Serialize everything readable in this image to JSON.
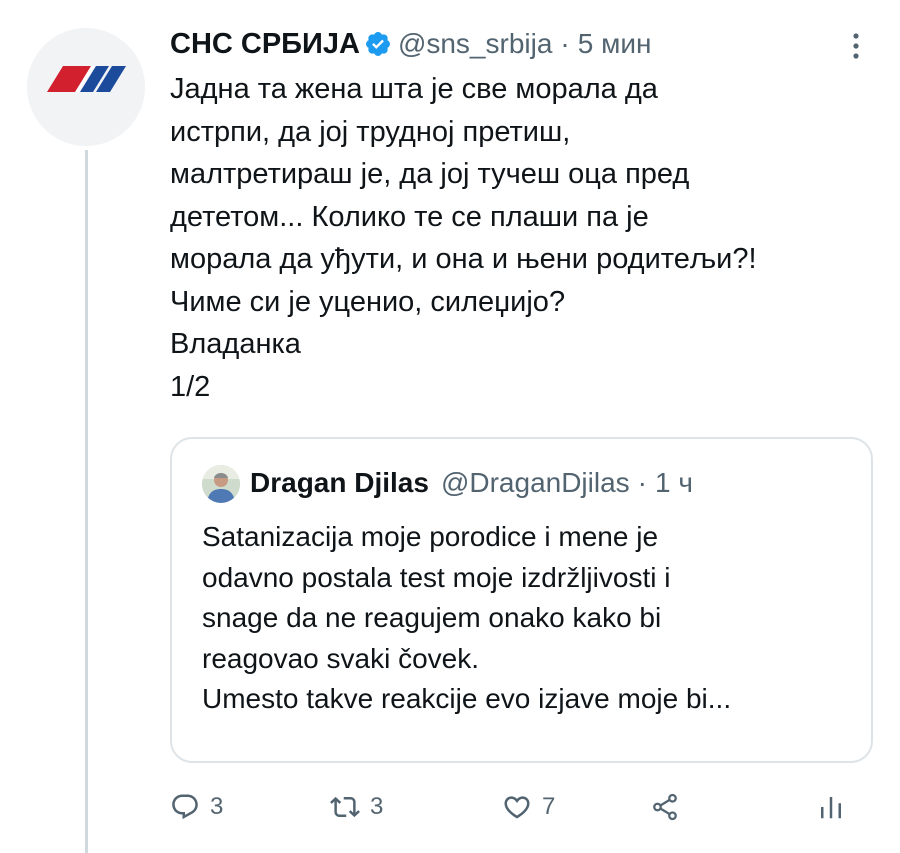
{
  "tweet": {
    "author": {
      "display_name": "СНС СРБИЈА",
      "handle": "@sns_srbija",
      "verified": true,
      "avatar_icon": "sns-logo-icon"
    },
    "separator": "·",
    "time": "5 мин",
    "more_icon": "more-vertical-icon",
    "text": "Јадна та жена шта је све морала да\nистрпи, да јој трудној претиш,\nмалтретираш је, да јој тучеш оца пред\nдететом... Колико те се плаши па је\nморала да уђути, и она и њени родитељи?!\nЧиме си је уценио, силеџијо?\nВладанка\n1/2",
    "quoted": {
      "display_name": "Dragan Djilas",
      "handle": "@DraganDjilas",
      "separator": "·",
      "time": "1 ч",
      "text": "Satanizacija moje porodice i mene je\nodavno postala test moje izdržljivosti i\nsnage da ne reagujem onako kako bi\nreagovao svaki čovek.\nUmesto takve reakcije evo izjave moje bi..."
    },
    "actions": {
      "reply": {
        "icon": "reply-icon",
        "count": "3"
      },
      "retweet": {
        "icon": "retweet-icon",
        "count": "3"
      },
      "like": {
        "icon": "heart-icon",
        "count": "7"
      },
      "share": {
        "icon": "share-icon"
      },
      "analytics": {
        "icon": "analytics-icon"
      }
    }
  },
  "colors": {
    "text_primary": "#0f1419",
    "text_secondary": "#536471",
    "verified_blue": "#1d9bf0",
    "border": "#dde3e7",
    "thread_line": "#cfd9de",
    "logo_red": "#d2202f",
    "logo_blue": "#1d4b9c"
  }
}
